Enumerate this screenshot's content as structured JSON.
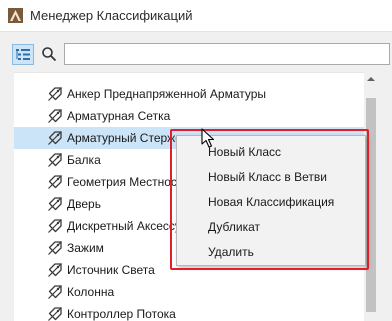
{
  "window": {
    "title": "Менеджер Классификаций",
    "icon": "archicad-app-icon"
  },
  "toolbar": {
    "view_toggle_icon": "tree-view-icon",
    "search_icon": "search-icon",
    "search_value": "",
    "search_placeholder": ""
  },
  "tree": {
    "items": [
      {
        "label": "Анкер Преднапряженной Арматуры"
      },
      {
        "label": "Арматурная Сетка"
      },
      {
        "label": "Арматурный Стержень",
        "selected": true
      },
      {
        "label": "Балка"
      },
      {
        "label": "Геометрия Местности"
      },
      {
        "label": "Дверь"
      },
      {
        "label": "Дискретный Аксессуар"
      },
      {
        "label": "Зажим"
      },
      {
        "label": "Источник Света"
      },
      {
        "label": "Колонна"
      },
      {
        "label": "Контроллер Потока"
      }
    ],
    "item_icon": "classification-tag-icon",
    "selected_color": "#cce4f7"
  },
  "context_menu": {
    "items": [
      {
        "label": "Новый Класс"
      },
      {
        "label": "Новый Класс в Ветви"
      },
      {
        "label": "Новая Классификация"
      },
      {
        "label": "Дубликат"
      },
      {
        "label": "Удалить"
      }
    ],
    "highlight_color": "#e01f2a"
  }
}
